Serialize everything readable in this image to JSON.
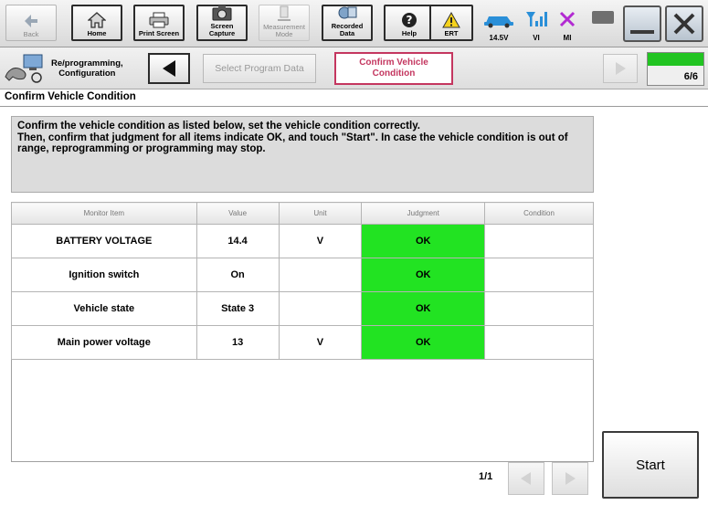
{
  "toolbar": {
    "back": "Back",
    "home": "Home",
    "print_screen": "Print Screen",
    "screen_capture": "Screen\nCapture",
    "measurement_mode": "Measurement\nMode",
    "recorded_data": "Recorded\nData",
    "help": "Help",
    "ert": "ERT",
    "battery_voltage": "14.5V",
    "vi": "VI",
    "mi": "MI"
  },
  "nav": {
    "reprogramming": "Re/programming,\nConfiguration",
    "step_previous": "Select Program Data",
    "step_current": "Confirm Vehicle\nCondition",
    "progress": "6/6",
    "progress_fraction": 1.0
  },
  "page": {
    "title": "Confirm Vehicle Condition",
    "instruction": "Confirm the vehicle condition as listed below, set the vehicle condition correctly.\nThen, confirm that judgment for all items indicate OK, and touch \"Start\". In case the vehicle condition is out of range, reprogramming or programming may stop."
  },
  "table": {
    "headers": {
      "monitor_item": "Monitor Item",
      "value": "Value",
      "unit": "Unit",
      "judgment": "Judgment",
      "condition": "Condition"
    },
    "rows": [
      {
        "item": "BATTERY VOLTAGE",
        "value": "14.4",
        "unit": "V",
        "judgment": "OK",
        "condition": ""
      },
      {
        "item": "Ignition switch",
        "value": "On",
        "unit": "",
        "judgment": "OK",
        "condition": ""
      },
      {
        "item": "Vehicle state",
        "value": "State 3",
        "unit": "",
        "judgment": "OK",
        "condition": ""
      },
      {
        "item": "Main power voltage",
        "value": "13",
        "unit": "V",
        "judgment": "OK",
        "condition": ""
      }
    ]
  },
  "pager": {
    "label": "1/1"
  },
  "start_button": "Start",
  "colors": {
    "ok_green": "#22e322",
    "active_step": "#c4365f",
    "progress_green": "#22c422"
  }
}
